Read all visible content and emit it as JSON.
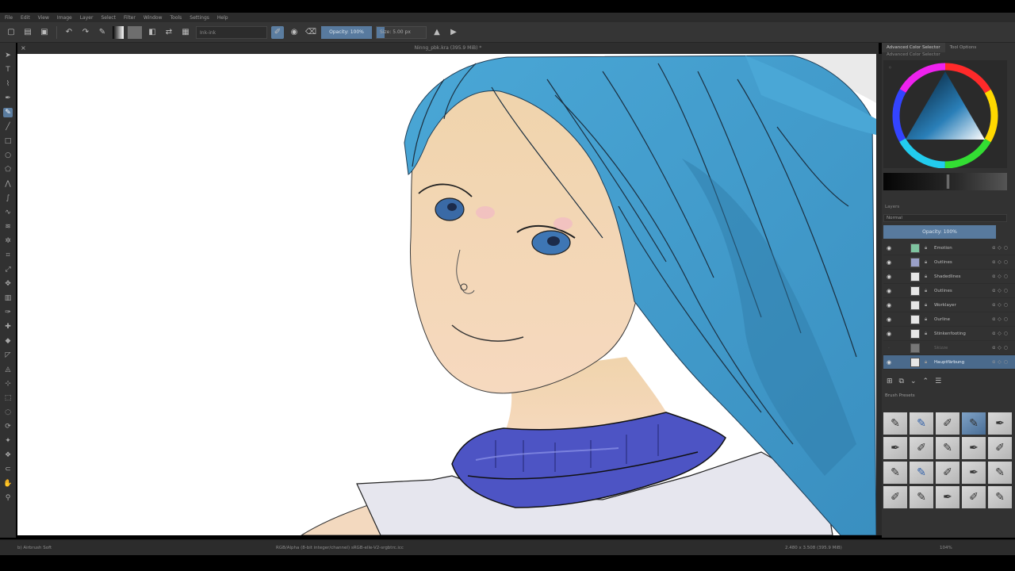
{
  "menu": {
    "items": [
      "File",
      "Edit",
      "View",
      "Image",
      "Layer",
      "Select",
      "Filter",
      "Window",
      "Tools",
      "Settings",
      "Help"
    ]
  },
  "toolbar": {
    "preset": "Ink-ink",
    "opacity_label": "Opacity: 100%",
    "size_label": "Size: 5.00 px"
  },
  "document": {
    "title": "Ninng_pbk.kra (395.9 MiB) *"
  },
  "dock": {
    "tabs": [
      "Advanced Color Selector",
      "Tool Options"
    ],
    "subtitle": "Advanced Color Selector",
    "layers_title": "Layers",
    "blend_mode": "Normal",
    "opacity_label": "Opacity: 100%",
    "brush_title": "Brush Presets"
  },
  "layers": [
    {
      "name": "Emotion",
      "thumb": "green"
    },
    {
      "name": "Outlines",
      "thumb": "dark"
    },
    {
      "name": "Shadedlines",
      "thumb": "light"
    },
    {
      "name": "Outlines",
      "thumb": "light"
    },
    {
      "name": "Worklayer",
      "thumb": "light"
    },
    {
      "name": "Ourline",
      "thumb": "light"
    },
    {
      "name": "Stinkenfooting",
      "thumb": "light"
    },
    {
      "name": "Skizze",
      "thumb": "light"
    },
    {
      "name": "Hauptfärbung",
      "thumb": "light"
    }
  ],
  "status": {
    "left": "b) Airbrush Soft",
    "center": "RGB/Alpha (8-bit integer/channel)  sRGB-elle-V2-srgbtrc.icc",
    "right": "2.480 x 3.508 (395.9 MiB)",
    "zoom": "104%"
  },
  "colors": {
    "accent": "#587a9e",
    "hair": "#3f9dcc",
    "skin": "#f5d7b3",
    "collar": "#4d54c4"
  }
}
